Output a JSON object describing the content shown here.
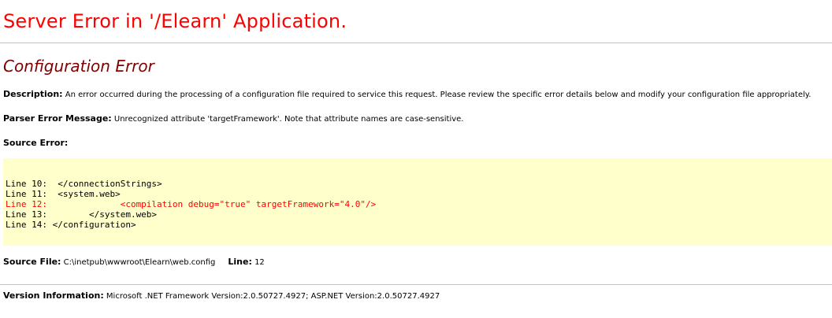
{
  "title": "Server Error in '/Elearn' Application.",
  "error_heading": "Configuration Error",
  "description": {
    "label": "Description:",
    "text": " An error occurred during the processing of a configuration file required to service this request. Please review the specific error details below and modify your configuration file appropriately."
  },
  "parser_error": {
    "label": "Parser Error Message:",
    "text": " Unrecognized attribute 'targetFramework'. Note that attribute names are case-sensitive."
  },
  "source_error_label": "Source Error:",
  "source_lines": [
    {
      "text": "Line 10:  </connectionStrings>",
      "error": false
    },
    {
      "text": "Line 11:  <system.web>",
      "error": false
    },
    {
      "text": "Line 12:              <compilation debug=\"true\" targetFramework=\"4.0\"/>",
      "error": true
    },
    {
      "text": "Line 13:        </system.web>",
      "error": false
    },
    {
      "text": "Line 14: </configuration>",
      "error": false
    }
  ],
  "source_file": {
    "label": "Source File:",
    "path": " C:\\inetpub\\wwwroot\\Elearn\\web.config",
    "line_label": "Line:",
    "line_value": " 12"
  },
  "version": {
    "label": "Version Information:",
    "text": " Microsoft .NET Framework Version:2.0.50727.4927; ASP.NET Version:2.0.50727.4927"
  },
  "colors": {
    "title": "#ff0000",
    "heading": "#800000",
    "code_background": "#ffffcc",
    "error_line": "#ff0000",
    "rule": "#c0c0c0"
  }
}
